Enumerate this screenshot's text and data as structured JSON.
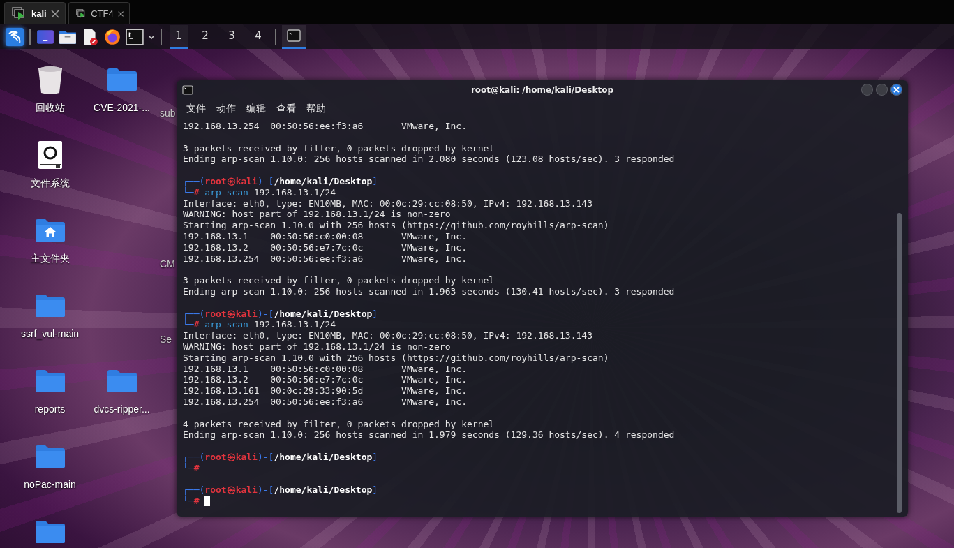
{
  "vm_tabs": [
    {
      "label": "kali",
      "selected": true
    },
    {
      "label": "CTF4",
      "selected": false
    }
  ],
  "taskbar": {
    "workspaces": [
      {
        "label": "1",
        "selected": true
      },
      {
        "label": "2",
        "selected": false
      },
      {
        "label": "3",
        "selected": false
      },
      {
        "label": "4",
        "selected": false
      }
    ],
    "window_task": {
      "selected": true
    }
  },
  "desktop": {
    "columns": [
      [
        {
          "kind": "trash",
          "label": "回收站"
        },
        {
          "kind": "drive",
          "label": "文件系统"
        },
        {
          "kind": "home",
          "label": "主文件夹"
        },
        {
          "kind": "folder",
          "label": "ssrf_vul-main"
        },
        {
          "kind": "folder",
          "label": "reports"
        },
        {
          "kind": "folder",
          "label": "noPac-main"
        },
        {
          "kind": "folder"
        }
      ],
      [
        {
          "kind": "folder",
          "label": "CVE-2021-..."
        },
        {
          "kind": "none"
        },
        {
          "kind": "none"
        },
        {
          "kind": "none"
        },
        {
          "kind": "folder",
          "label": "dvcs-ripper..."
        }
      ],
      [
        {
          "kind": "text",
          "label": "sub"
        },
        {
          "kind": "none"
        },
        {
          "kind": "text",
          "label": "CM"
        },
        {
          "kind": "text",
          "label": "Se"
        }
      ]
    ]
  },
  "terminal": {
    "title": "root@kali: /home/kali/Desktop",
    "menu": [
      "文件",
      "动作",
      "编辑",
      "查看",
      "帮助"
    ],
    "lines": [
      {
        "kind": "output",
        "text": "192.168.13.254  00:50:56:ee:f3:a6       VMware, Inc."
      },
      {
        "kind": "blank"
      },
      {
        "kind": "output",
        "text": "3 packets received by filter, 0 packets dropped by kernel"
      },
      {
        "kind": "output",
        "text": "Ending arp-scan 1.10.0: 256 hosts scanned in 2.080 seconds (123.08 hosts/sec). 3 responded"
      },
      {
        "kind": "blank"
      },
      {
        "kind": "prompt",
        "open": "┌──(",
        "user": "root",
        "at": "㉿",
        "host": "kali",
        "mid": ")-[",
        "path": "/home/kali/Desktop",
        "close": "]"
      },
      {
        "kind": "command",
        "corner": "└─",
        "sign": "#",
        "program": "arp-scan",
        "args": "192.168.13.1/24",
        "cursor": false
      },
      {
        "kind": "output",
        "text": "Interface: eth0, type: EN10MB, MAC: 00:0c:29:cc:08:50, IPv4: 192.168.13.143"
      },
      {
        "kind": "output",
        "text": "WARNING: host part of 192.168.13.1/24 is non-zero"
      },
      {
        "kind": "output",
        "text": "Starting arp-scan 1.10.0 with 256 hosts (https://github.com/royhills/arp-scan)"
      },
      {
        "kind": "output",
        "text": "192.168.13.1    00:50:56:c0:00:08       VMware, Inc."
      },
      {
        "kind": "output",
        "text": "192.168.13.2    00:50:56:e7:7c:0c       VMware, Inc."
      },
      {
        "kind": "output",
        "text": "192.168.13.254  00:50:56:ee:f3:a6       VMware, Inc."
      },
      {
        "kind": "blank"
      },
      {
        "kind": "output",
        "text": "3 packets received by filter, 0 packets dropped by kernel"
      },
      {
        "kind": "output",
        "text": "Ending arp-scan 1.10.0: 256 hosts scanned in 1.963 seconds (130.41 hosts/sec). 3 responded"
      },
      {
        "kind": "blank"
      },
      {
        "kind": "prompt",
        "open": "┌──(",
        "user": "root",
        "at": "㉿",
        "host": "kali",
        "mid": ")-[",
        "path": "/home/kali/Desktop",
        "close": "]"
      },
      {
        "kind": "command",
        "corner": "└─",
        "sign": "#",
        "program": "arp-scan",
        "args": "192.168.13.1/24",
        "cursor": false
      },
      {
        "kind": "output",
        "text": "Interface: eth0, type: EN10MB, MAC: 00:0c:29:cc:08:50, IPv4: 192.168.13.143"
      },
      {
        "kind": "output",
        "text": "WARNING: host part of 192.168.13.1/24 is non-zero"
      },
      {
        "kind": "output",
        "text": "Starting arp-scan 1.10.0 with 256 hosts (https://github.com/royhills/arp-scan)"
      },
      {
        "kind": "output",
        "text": "192.168.13.1    00:50:56:c0:00:08       VMware, Inc."
      },
      {
        "kind": "output",
        "text": "192.168.13.2    00:50:56:e7:7c:0c       VMware, Inc."
      },
      {
        "kind": "output",
        "text": "192.168.13.161  00:0c:29:33:90:5d       VMware, Inc."
      },
      {
        "kind": "output",
        "text": "192.168.13.254  00:50:56:ee:f3:a6       VMware, Inc."
      },
      {
        "kind": "blank"
      },
      {
        "kind": "output",
        "text": "4 packets received by filter, 0 packets dropped by kernel"
      },
      {
        "kind": "output",
        "text": "Ending arp-scan 1.10.0: 256 hosts scanned in 1.979 seconds (129.36 hosts/sec). 4 responded"
      },
      {
        "kind": "blank"
      },
      {
        "kind": "prompt",
        "open": "┌──(",
        "user": "root",
        "at": "㉿",
        "host": "kali",
        "mid": ")-[",
        "path": "/home/kali/Desktop",
        "close": "]"
      },
      {
        "kind": "command",
        "corner": "└─",
        "sign": "#",
        "cursor": false
      },
      {
        "kind": "blank"
      },
      {
        "kind": "prompt",
        "open": "┌──(",
        "user": "root",
        "at": "㉿",
        "host": "kali",
        "mid": ")-[",
        "path": "/home/kali/Desktop",
        "close": "]"
      },
      {
        "kind": "command",
        "corner": "└─",
        "sign": "#",
        "cursor": true
      }
    ]
  }
}
